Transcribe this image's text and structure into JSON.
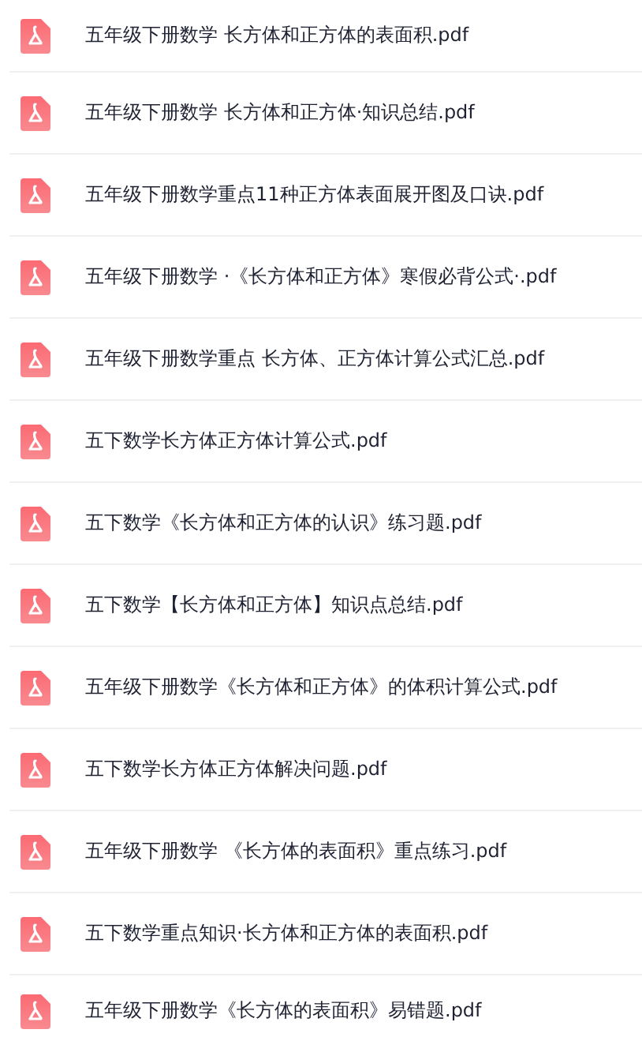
{
  "files": [
    {
      "name": "五年级下册数学 长方体和正方体的表面积.pdf"
    },
    {
      "name": "五年级下册数学 长方体和正方体·知识总结.pdf"
    },
    {
      "name": "五年级下册数学重点11种正方体表面展开图及口诀.pdf"
    },
    {
      "name": "五年级下册数学 ·《长方体和正方体》寒假必背公式·.pdf"
    },
    {
      "name": "五年级下册数学重点 长方体、正方体计算公式汇总.pdf"
    },
    {
      "name": "五下数学长方体正方体计算公式.pdf"
    },
    {
      "name": "五下数学《长方体和正方体的认识》练习题.pdf"
    },
    {
      "name": "五下数学【长方体和正方体】知识点总结.pdf"
    },
    {
      "name": "五年级下册数学《长方体和正方体》的体积计算公式.pdf"
    },
    {
      "name": "五下数学长方体正方体解决问题.pdf"
    },
    {
      "name": "五年级下册数学 《长方体的表面积》重点练习.pdf"
    },
    {
      "name": "五下数学重点知识·长方体和正方体的表面积.pdf"
    },
    {
      "name": "五年级下册数学《长方体的表面积》易错题.pdf"
    }
  ]
}
